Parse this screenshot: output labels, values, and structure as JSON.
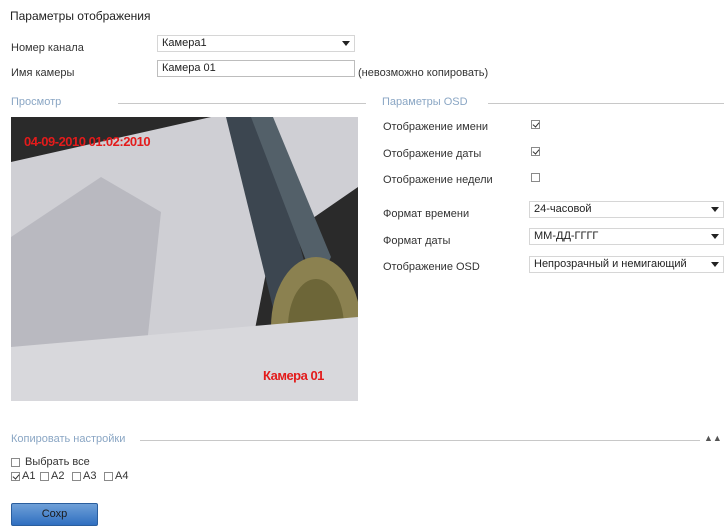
{
  "page": {
    "title": "Параметры отображения"
  },
  "channel": {
    "label": "Номер канала",
    "value": "Камера1"
  },
  "camera_name": {
    "label": "Имя камеры",
    "value": "Камера 01",
    "note": "(невозможно копировать)"
  },
  "preview": {
    "section_title": "Просмотр",
    "overlay_datetime": "04-09-2010 01:02:2010",
    "overlay_name": "Камера 01"
  },
  "osd": {
    "section_title": "Параметры OSD",
    "show_name_label": "Отображение имени",
    "show_name_checked": true,
    "show_date_label": "Отображение даты",
    "show_date_checked": true,
    "show_week_label": "Отображение недели",
    "show_week_checked": false,
    "time_format_label": "Формат времени",
    "time_format_value": "24-часовой",
    "date_format_label": "Формат даты",
    "date_format_value": "ММ-ДД-ГГГГ",
    "osd_mode_label": "Отображение OSD",
    "osd_mode_value": "Непрозрачный и немигающий"
  },
  "copy": {
    "section_title": "Копировать настройки",
    "select_all_label": "Выбрать все",
    "select_all_checked": false,
    "channels": [
      {
        "label": "A1",
        "checked": true
      },
      {
        "label": "A2",
        "checked": false
      },
      {
        "label": "A3",
        "checked": false
      },
      {
        "label": "A4",
        "checked": false
      }
    ]
  },
  "actions": {
    "save_label": "Сохр"
  },
  "icons": {
    "select_arrow": "chevron-down-icon",
    "collapse": "collapse-icon"
  }
}
